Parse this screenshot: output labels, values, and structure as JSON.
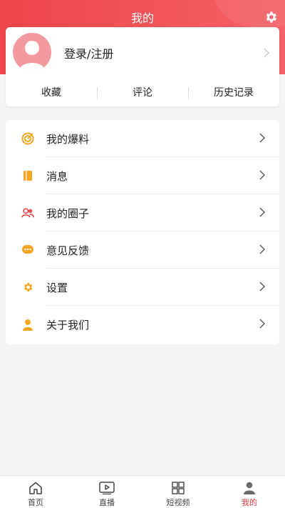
{
  "header": {
    "title": "我的"
  },
  "profile": {
    "login_label": "登录/注册"
  },
  "stats": [
    {
      "label": "收藏"
    },
    {
      "label": "评论"
    },
    {
      "label": "历史记录"
    }
  ],
  "menu": [
    {
      "label": "我的爆料",
      "icon": "target-icon"
    },
    {
      "label": "消息",
      "icon": "book-icon"
    },
    {
      "label": "我的圈子",
      "icon": "users-icon"
    },
    {
      "label": "意见反馈",
      "icon": "chat-bubble-icon"
    },
    {
      "label": "设置",
      "icon": "gear-icon"
    },
    {
      "label": "关于我们",
      "icon": "person-icon"
    }
  ],
  "bottom_nav": [
    {
      "label": "首页",
      "icon": "home-icon"
    },
    {
      "label": "直播",
      "icon": "play-icon"
    },
    {
      "label": "短视频",
      "icon": "grid-icon"
    },
    {
      "label": "我的",
      "icon": "user-icon",
      "active": true
    }
  ],
  "colors": {
    "brand": "#f0454d",
    "icon_orange": "#f5a623",
    "active_nav": "#e8383f"
  }
}
